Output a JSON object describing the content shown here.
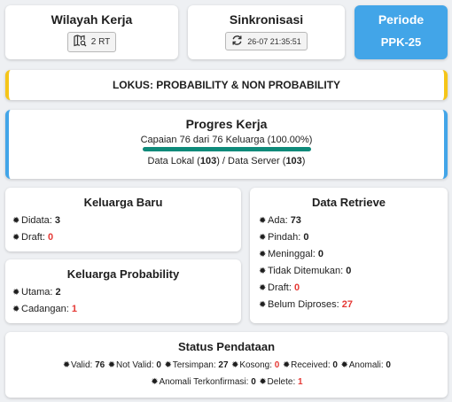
{
  "header": {
    "wilayah": {
      "title": "Wilayah Kerja",
      "chip": "2 RT",
      "icon": "map-search-icon"
    },
    "sinkron": {
      "title": "Sinkronisasi",
      "chip": "26-07 21:35:51",
      "icon": "sync-icon"
    },
    "periode": {
      "title": "Periode",
      "value": "PPK-25",
      "color": "#42a5e8"
    }
  },
  "lokus": {
    "label": "LOKUS: PROBABILITY & NON PROBABILITY",
    "accent": "#f5c518"
  },
  "progres": {
    "title": "Progres Kerja",
    "capaian": "Capaian 76 dari 76 Keluarga (100.00%)",
    "percent": 100,
    "bar_color": "#0f8a7a",
    "data_prefix": "Data Lokal (",
    "lokal": "103",
    "data_mid": ") / Data Server (",
    "server": "103",
    "data_suffix": ")",
    "accent": "#42a5e8"
  },
  "keluarga_baru": {
    "title": "Keluarga Baru",
    "items": [
      {
        "label": "Didata: ",
        "value": "3",
        "red": false
      },
      {
        "label": "Draft: ",
        "value": "0",
        "red": true
      }
    ]
  },
  "keluarga_probability": {
    "title": "Keluarga Probability",
    "items": [
      {
        "label": "Utama: ",
        "value": "2",
        "red": false
      },
      {
        "label": "Cadangan: ",
        "value": "1",
        "red": true
      }
    ]
  },
  "data_retrieve": {
    "title": "Data Retrieve",
    "items": [
      {
        "label": "Ada: ",
        "value": "73",
        "red": false
      },
      {
        "label": "Pindah: ",
        "value": "0",
        "red": false
      },
      {
        "label": "Meninggal: ",
        "value": "0",
        "red": false
      },
      {
        "label": "Tidak Ditemukan: ",
        "value": "0",
        "red": false
      },
      {
        "label": "Draft: ",
        "value": "0",
        "red": true
      },
      {
        "label": "Belum Diproses: ",
        "value": "27",
        "red": true
      }
    ]
  },
  "status": {
    "title": "Status Pendataan",
    "line1": [
      {
        "label": "Valid: ",
        "value": "76",
        "red": false
      },
      {
        "label": "Not Valid: ",
        "value": "0",
        "red": false
      },
      {
        "label": "Tersimpan: ",
        "value": "27",
        "red": false
      },
      {
        "label": "Kosong: ",
        "value": "0",
        "red": true
      },
      {
        "label": "Received: ",
        "value": "0",
        "red": false
      },
      {
        "label": "Anomali: ",
        "value": "0",
        "red": false
      }
    ],
    "line2": [
      {
        "label": "Anomali Terkonfirmasi: ",
        "value": "0",
        "red": false
      },
      {
        "label": "Delete: ",
        "value": "1",
        "red": true
      }
    ]
  },
  "bullet_char": "✹"
}
